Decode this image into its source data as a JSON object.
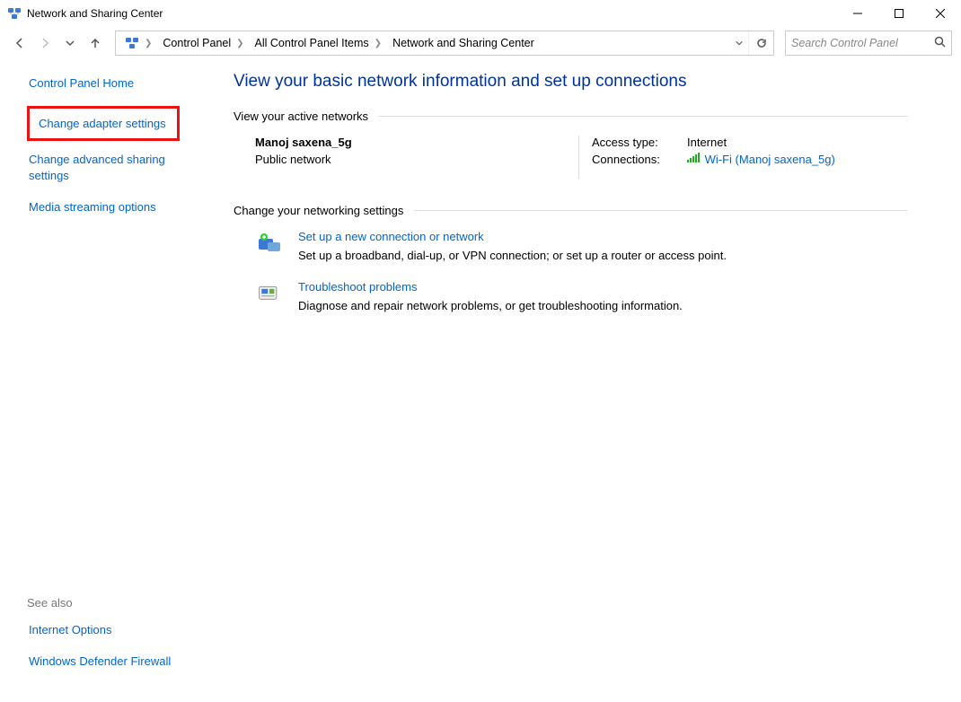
{
  "titlebar": {
    "title": "Network and Sharing Center"
  },
  "breadcrumb": {
    "items": [
      "Control Panel",
      "All Control Panel Items",
      "Network and Sharing Center"
    ]
  },
  "search": {
    "placeholder": "Search Control Panel"
  },
  "sidebar": {
    "home": "Control Panel Home",
    "change_adapter": "Change adapter settings",
    "change_advanced": "Change advanced sharing settings",
    "media_streaming": "Media streaming options",
    "see_also_heading": "See also",
    "see_also": {
      "internet_options": "Internet Options",
      "firewall": "Windows Defender Firewall"
    }
  },
  "main": {
    "heading": "View your basic network information and set up connections",
    "group_active": "View your active networks",
    "network": {
      "name": "Manoj saxena_5g",
      "type": "Public network",
      "access_label": "Access type:",
      "access_value": "Internet",
      "connections_label": "Connections:",
      "connections_value": "Wi-Fi (Manoj saxena_5g)"
    },
    "group_change": "Change your networking settings",
    "action_setup": {
      "title": "Set up a new connection or network",
      "desc": "Set up a broadband, dial-up, or VPN connection; or set up a router or access point."
    },
    "action_troubleshoot": {
      "title": "Troubleshoot problems",
      "desc": "Diagnose and repair network problems, or get troubleshooting information."
    }
  }
}
